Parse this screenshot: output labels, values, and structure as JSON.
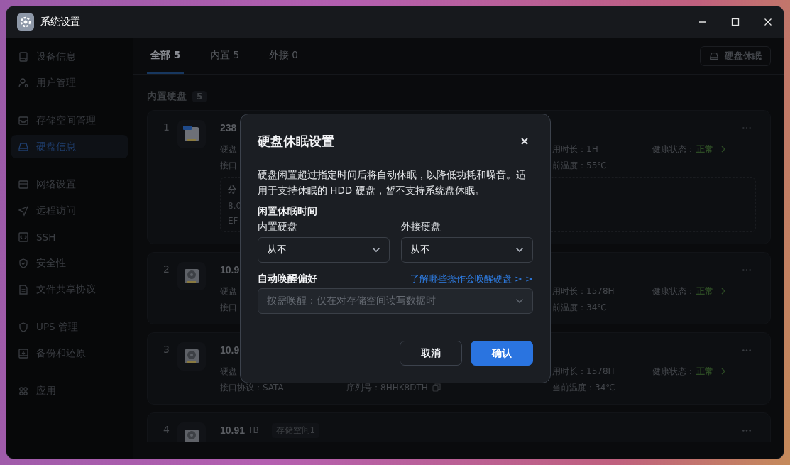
{
  "window": {
    "title": "系统设置"
  },
  "sidebar": {
    "groups": [
      {
        "items": [
          {
            "label": "设备信息",
            "selected": false
          },
          {
            "label": "用户管理",
            "selected": false
          }
        ]
      },
      {
        "items": [
          {
            "label": "存储空间管理",
            "selected": false
          },
          {
            "label": "硬盘信息",
            "selected": true
          }
        ]
      },
      {
        "items": [
          {
            "label": "网络设置",
            "selected": false
          },
          {
            "label": "远程访问",
            "selected": false
          },
          {
            "label": "SSH",
            "selected": false
          },
          {
            "label": "安全性",
            "selected": false
          },
          {
            "label": "文件共享协议",
            "selected": false
          }
        ]
      },
      {
        "items": [
          {
            "label": "UPS 管理",
            "selected": false
          },
          {
            "label": "备份和还原",
            "selected": false
          }
        ]
      },
      {
        "items": [
          {
            "label": "应用",
            "selected": false
          }
        ]
      }
    ]
  },
  "tabs": [
    {
      "label": "全部",
      "count": "5",
      "selected": true
    },
    {
      "label": "内置",
      "count": "5",
      "selected": false
    },
    {
      "label": "外接",
      "count": "0",
      "selected": false
    }
  ],
  "sleep_button": "硬盘休眠",
  "section": {
    "title": "内置硬盘",
    "count": "5"
  },
  "disks": [
    {
      "index": "1",
      "kind": "ssd",
      "capacity": "238",
      "type": "硬盘",
      "interface": "接口",
      "usage": "用时长：1H",
      "health_label": "健康状态：",
      "health": "正常",
      "temperature": "前温度：55℃",
      "partitions": {
        "title": "分",
        "size": "8.0",
        "name": "EF"
      }
    },
    {
      "index": "2",
      "kind": "hdd",
      "capacity": "10.9",
      "type": "硬盘",
      "interface": "接口",
      "usage": "用时长：1578H",
      "health_label": "健康状态：",
      "health": "正常",
      "temperature": "前温度：34℃"
    },
    {
      "index": "3",
      "kind": "hdd",
      "capacity": "10.9",
      "type": "硬盘",
      "interface": "接口协议：SATA",
      "serial": "序列号：8HHK8DTH",
      "usage": "用时长：1578H",
      "health_label": "健康状态：",
      "health": "正常",
      "temperature": "当前温度：34℃"
    },
    {
      "index": "4",
      "kind": "hdd",
      "capacity": "10.91",
      "unit": "TB",
      "tag": "存储空间1"
    }
  ],
  "dialog": {
    "title": "硬盘休眠设置",
    "description": "硬盘闲置超过指定时间后将自动休眠，以降低功耗和噪音。适用于支持休眠的 HDD 硬盘，暂不支持系统盘休眠。",
    "idle_title": "闲置休眠时间",
    "selects": [
      {
        "label": "内置硬盘",
        "value": "从不"
      },
      {
        "label": "外接硬盘",
        "value": "从不"
      }
    ],
    "wake_title": "自动唤醒偏好",
    "wake_link": "了解哪些操作会唤醒硬盘 > >",
    "wake_select": {
      "value": "按需唤醒：仅在对存储空间读写数据时",
      "disabled": true
    },
    "buttons": [
      {
        "label": "取消",
        "kind": "secondary"
      },
      {
        "label": "确认",
        "kind": "primary"
      }
    ]
  }
}
